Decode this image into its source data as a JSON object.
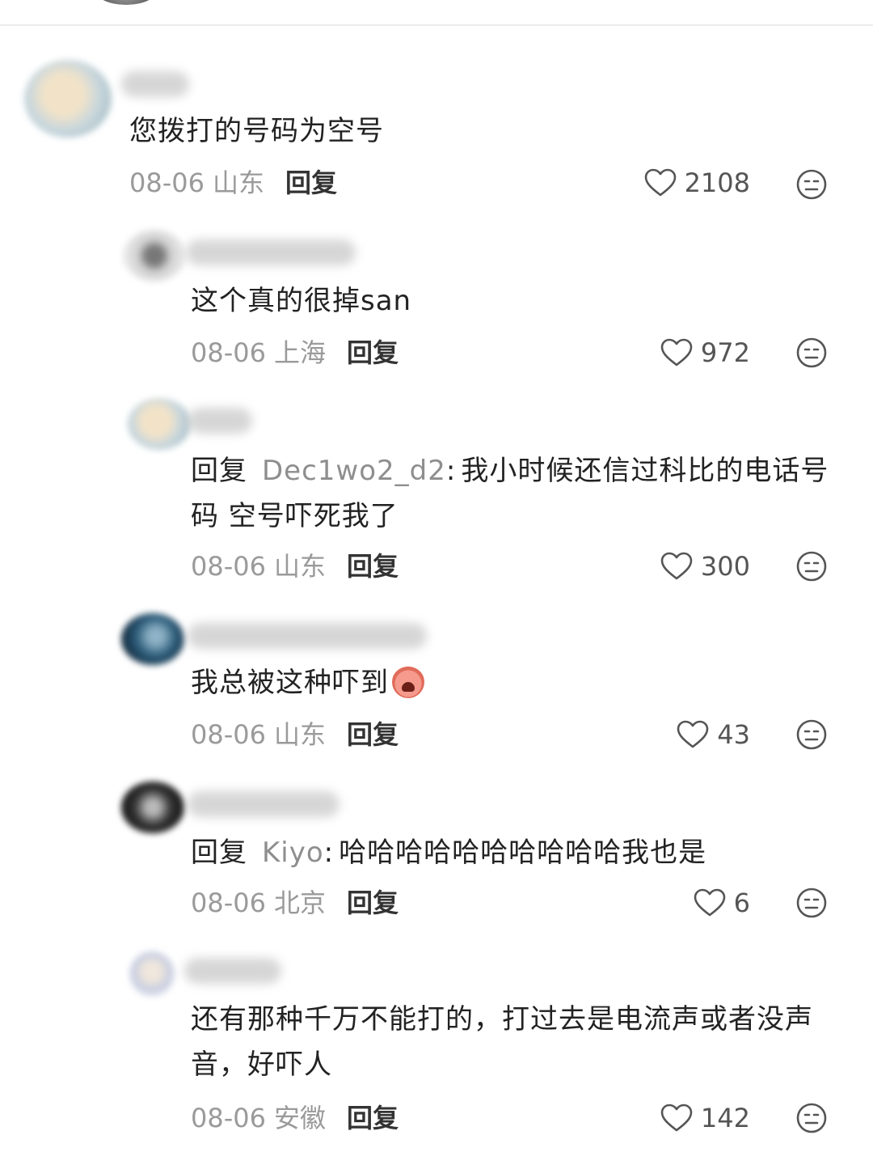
{
  "comments": [
    {
      "text": "您拨打的号码为空号",
      "date": "08-06",
      "region": "山东",
      "reply_label": "回复",
      "likes": "2108"
    },
    {
      "text": "这个真的很掉san",
      "date": "08-06",
      "region": "上海",
      "reply_label": "回复",
      "likes": "972"
    },
    {
      "reply_prefix": "回复",
      "reply_to": "Dec1wo2_d2",
      "colon": ":",
      "text_line1": "我小时候还信过科比的电话号",
      "text_line2": "码 空号吓死我了",
      "date": "08-06",
      "region": "山东",
      "reply_label": "回复",
      "likes": "300"
    },
    {
      "text": "我总被这种吓到",
      "emoji": "scared-face-emoji",
      "date": "08-06",
      "region": "山东",
      "reply_label": "回复",
      "likes": "43"
    },
    {
      "reply_prefix": "回复",
      "reply_to": "Kiyo",
      "colon": ":",
      "text": "哈哈哈哈哈哈哈哈哈哈我也是",
      "date": "08-06",
      "region": "北京",
      "reply_label": "回复",
      "likes": "6"
    },
    {
      "text_line1": "还有那种千万不能打的，打过去是电流声或者没声",
      "text_line2": "音，好吓人",
      "date": "08-06",
      "region": "安徽",
      "reply_label": "回复",
      "likes": "142"
    }
  ],
  "colors": {
    "text": "#222222",
    "meta": "#9a9a9a",
    "reply_name": "#8e8e8e",
    "icon": "#555555"
  }
}
